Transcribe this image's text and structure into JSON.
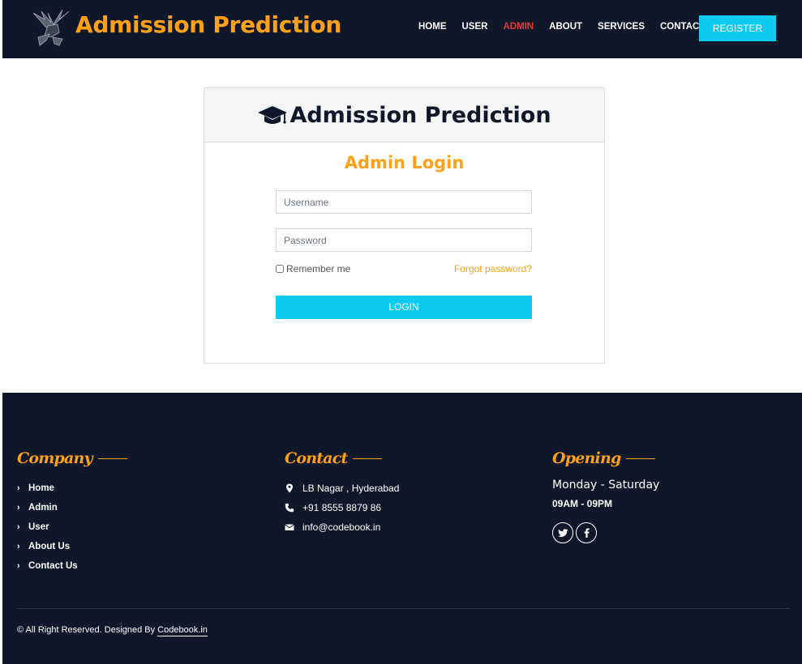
{
  "brand": {
    "name": "Admission Prediction"
  },
  "nav": {
    "links": [
      {
        "label": "HOME"
      },
      {
        "label": "USER"
      },
      {
        "label": "ADMIN"
      },
      {
        "label": "ABOUT"
      },
      {
        "label": "SERVICES"
      },
      {
        "label": "CONTACT"
      }
    ],
    "active": "ADMIN",
    "register_label": "REGISTER"
  },
  "card": {
    "title": "Admission Prediction",
    "subtitle": "Admin Login",
    "username_placeholder": "Username",
    "password_placeholder": "Password",
    "remember_label": "Remember me",
    "forgot_label": "Forgot password?",
    "login_label": "LOGIN"
  },
  "footer": {
    "company": {
      "heading": "Company",
      "links": [
        "Home",
        "Admin",
        "User",
        "About Us",
        "Contact Us"
      ]
    },
    "contact": {
      "heading": "Contact",
      "address": "LB Nagar , Hyderabad",
      "phone": "+91 8555 8879 86",
      "email": "info@codebook.in"
    },
    "opening": {
      "heading": "Opening",
      "days": "Monday - Saturday",
      "hours": "09AM - 09PM"
    },
    "copyright": "© All Right Reserved. Designed By",
    "designer_link": "Codebook.in"
  },
  "colors": {
    "dark": "#0f172b",
    "accent": "#fea116",
    "button": "#0dcaf0",
    "active_nav": "#e53935"
  }
}
